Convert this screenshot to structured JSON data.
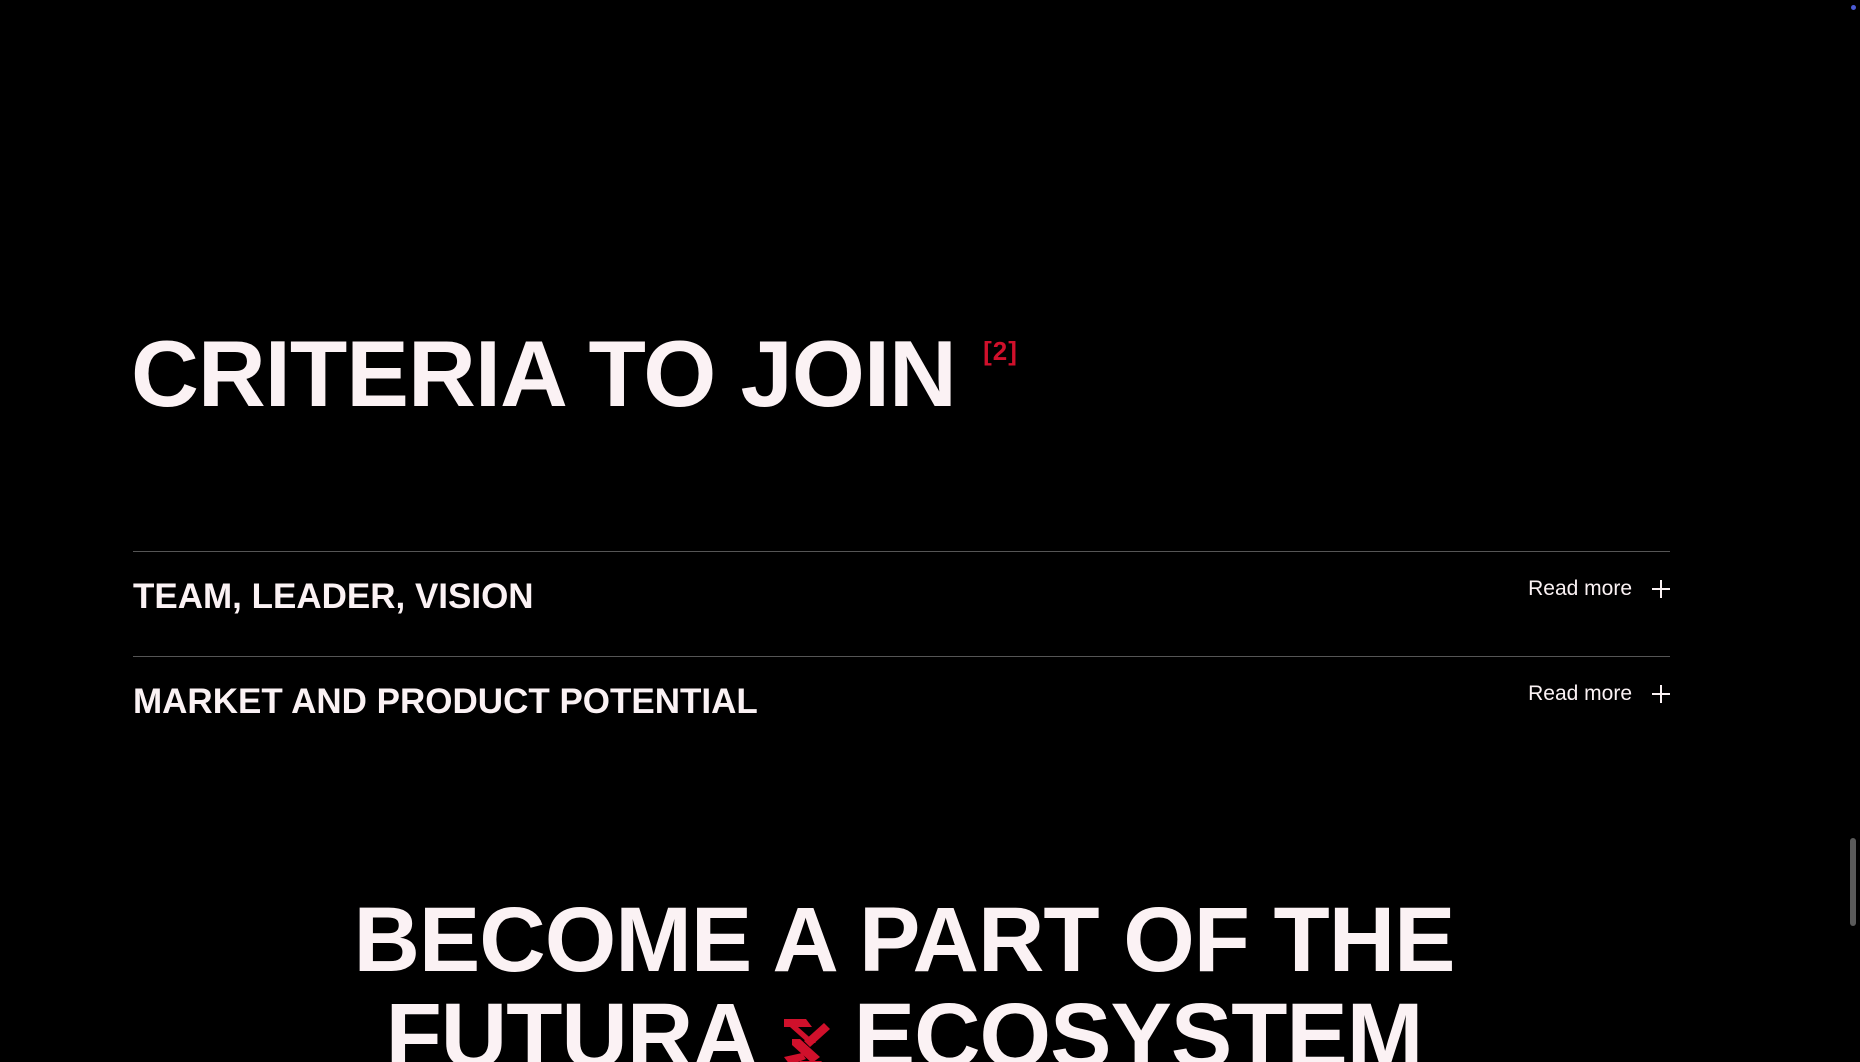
{
  "criteria": {
    "title": "CRITERIA TO JOIN",
    "ref": "[2]"
  },
  "accordion": {
    "items": [
      {
        "title": "TEAM, LEADER, VISION",
        "toggle_label": "Read more",
        "icon": "plus-icon"
      },
      {
        "title": "MARKET AND PRODUCT POTENTIAL",
        "toggle_label": "Read more",
        "icon": "plus-icon"
      }
    ]
  },
  "cta": {
    "line1": "BECOME A PART OF THE",
    "line2_left": "FUTURA",
    "line2_right": "ECOSYSTEM",
    "logo_icon": "futura-logo-icon"
  },
  "colors": {
    "background": "#000000",
    "text": "#fbf2f4",
    "accent": "#d0102b",
    "divider": "#555555"
  }
}
